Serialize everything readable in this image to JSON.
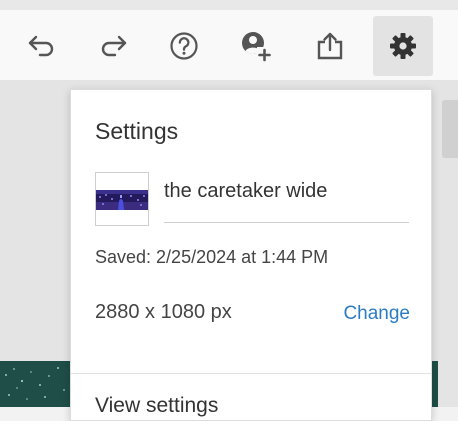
{
  "toolbar": {
    "buttons": [
      {
        "icon": "undo-icon"
      },
      {
        "icon": "redo-icon"
      },
      {
        "icon": "help-icon"
      },
      {
        "icon": "add-user-icon"
      },
      {
        "icon": "share-icon"
      },
      {
        "icon": "gear-icon",
        "active": true
      }
    ]
  },
  "settings": {
    "title": "Settings",
    "project_name": "the caretaker wide",
    "saved": "Saved: 2/25/2024 at 1:44 PM",
    "dimensions": "2880 x 1080 px",
    "change_label": "Change",
    "view_settings_label": "View settings"
  },
  "colors": {
    "accent": "#2c7cc3",
    "toolbar_bg": "#f9f9f9",
    "active_bg": "#e3e3e3",
    "canvas_teal": "#1f4d47"
  }
}
